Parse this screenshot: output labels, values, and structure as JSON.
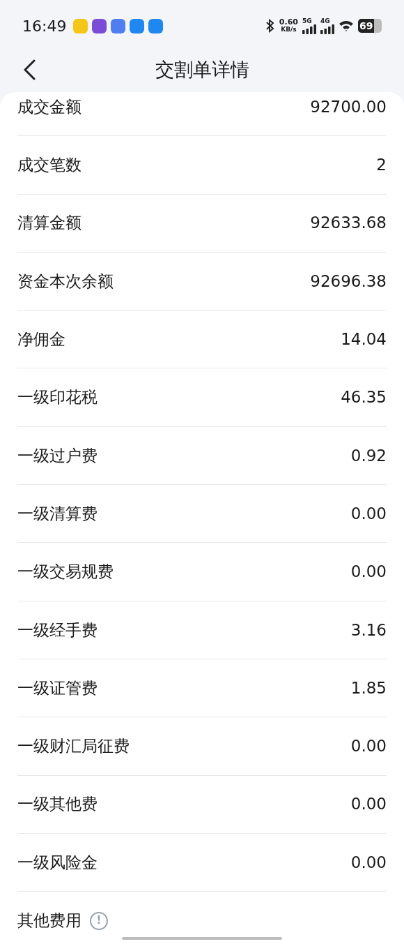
{
  "status_bar": {
    "time": "16:49",
    "speed_value": "0.60",
    "speed_unit": "KB/s",
    "networks": [
      "5G",
      "4G"
    ],
    "battery": "69"
  },
  "header": {
    "title": "交割单详情"
  },
  "rows": [
    {
      "label": "成交金额",
      "value": "92700.00"
    },
    {
      "label": "成交笔数",
      "value": "2"
    },
    {
      "label": "清算金额",
      "value": "92633.68"
    },
    {
      "label": "资金本次余额",
      "value": "92696.38"
    },
    {
      "label": "净佣金",
      "value": "14.04"
    },
    {
      "label": "一级印花税",
      "value": "46.35"
    },
    {
      "label": "一级过户费",
      "value": "0.92"
    },
    {
      "label": "一级清算费",
      "value": "0.00"
    },
    {
      "label": "一级交易规费",
      "value": "0.00"
    },
    {
      "label": "一级经手费",
      "value": "3.16"
    },
    {
      "label": "一级证管费",
      "value": "1.85"
    },
    {
      "label": "一级财汇局征费",
      "value": "0.00"
    },
    {
      "label": "一级其他费",
      "value": "0.00"
    },
    {
      "label": "一级风险金",
      "value": "0.00"
    }
  ],
  "footer_row": {
    "label": "其他费用",
    "info_icon": "!"
  }
}
